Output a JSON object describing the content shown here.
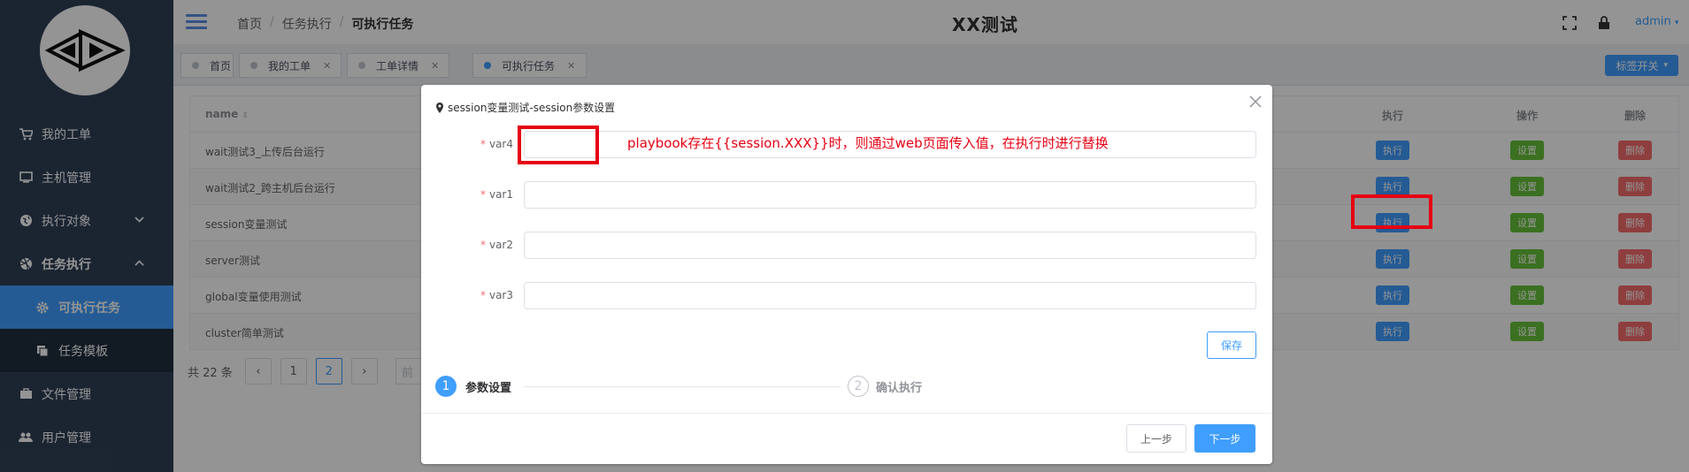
{
  "sidebar": {
    "items": [
      {
        "label": "我的工单",
        "icon": "cart-icon"
      },
      {
        "label": "主机管理",
        "icon": "monitor-icon"
      },
      {
        "label": "执行对象",
        "icon": "globe-icon"
      },
      {
        "label": "任务执行",
        "icon": "dribbble-icon"
      },
      {
        "label": "可执行任务",
        "icon": "gear-icon"
      },
      {
        "label": "任务模板",
        "icon": "copy-icon"
      },
      {
        "label": "文件管理",
        "icon": "briefcase-icon"
      },
      {
        "label": "用户管理",
        "icon": "users-icon"
      }
    ]
  },
  "header": {
    "breadcrumb": [
      "首页",
      "任务执行",
      "可执行任务"
    ],
    "title": "XX测试",
    "user": "admin"
  },
  "tags": {
    "items": [
      {
        "label": "首页",
        "closable": false
      },
      {
        "label": "我的工单",
        "closable": true
      },
      {
        "label": "工单详情",
        "closable": true
      },
      {
        "label": "可执行任务",
        "closable": true,
        "active": true
      }
    ],
    "switch_label": "标签开关"
  },
  "table": {
    "columns": {
      "name": "name",
      "exec": "执行",
      "op": "操作",
      "del": "删除"
    },
    "rows": [
      {
        "name": "wait测试3_上传后台运行"
      },
      {
        "name": "wait测试2_跨主机后台运行"
      },
      {
        "name": "session变量测试"
      },
      {
        "name": "server测试"
      },
      {
        "name": "global变量使用测试"
      },
      {
        "name": "cluster简单测试"
      }
    ],
    "exec_label": "执行",
    "set_label": "设置",
    "del_label": "删除"
  },
  "pagination": {
    "total": "共 22 条",
    "pages": [
      "1",
      "2"
    ],
    "current": "2",
    "goto_partial": "前"
  },
  "dialog": {
    "title": "session变量测试-session参数设置",
    "fields": [
      {
        "label": "var4",
        "value": ""
      },
      {
        "label": "var1",
        "value": ""
      },
      {
        "label": "var2",
        "value": ""
      },
      {
        "label": "var3",
        "value": ""
      }
    ],
    "annotation": "playbook存在{{session.XXX}}时，则通过web页面传入值，在执行时进行替换",
    "save_label": "保存",
    "steps": [
      {
        "num": "1",
        "label": "参数设置"
      },
      {
        "num": "2",
        "label": "确认执行"
      }
    ],
    "prev_label": "上一步",
    "next_label": "下一步"
  },
  "colors": {
    "primary": "#409eff",
    "success": "#67c23a",
    "danger": "#f56c6c",
    "sidebar": "#304156",
    "annotation": "#e60012"
  }
}
